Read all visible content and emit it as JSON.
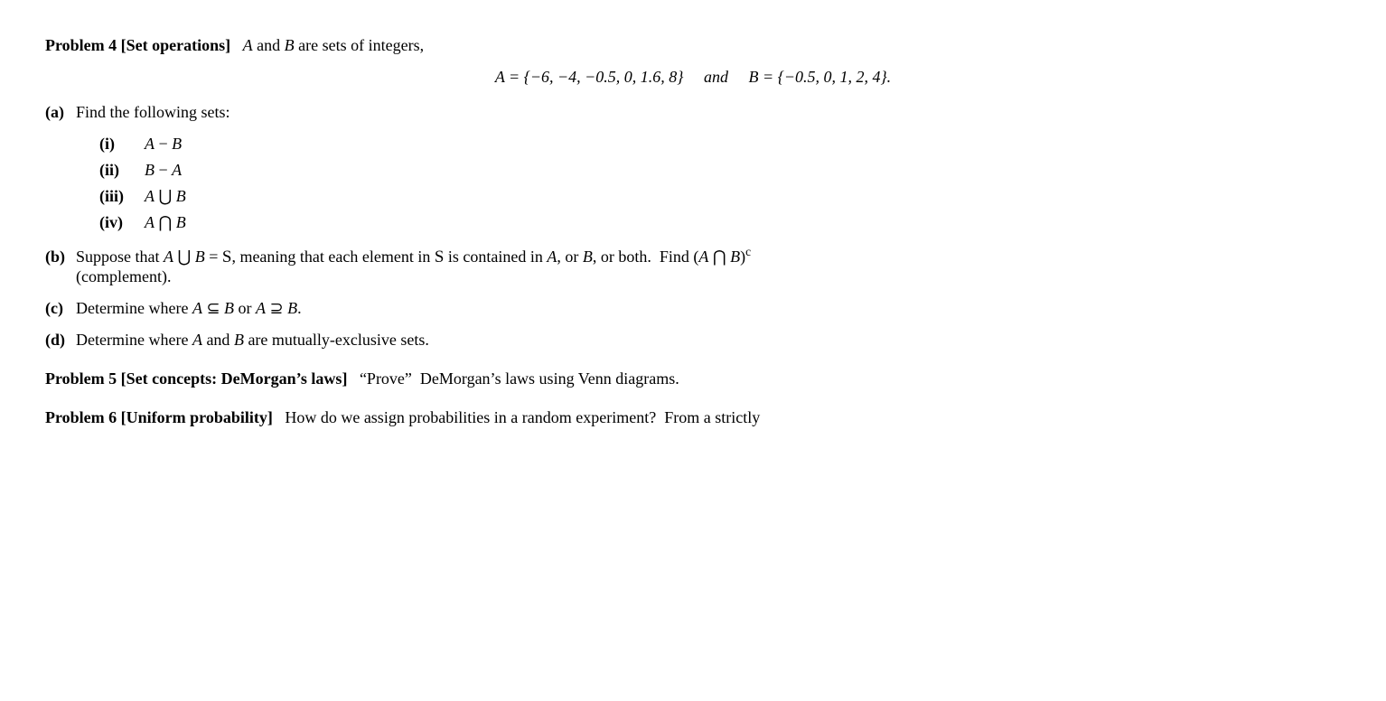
{
  "problems": [
    {
      "id": "problem4",
      "title": "Problem 4",
      "tag": "[Set operations]",
      "intro": "A and B are sets of integers,",
      "display_math": "A = {−6, −4, −0.5, 0, 1.6, 8}   and   B = {−0.5, 0, 1, 2, 4}.",
      "parts": [
        {
          "label": "(a)",
          "text": "Find the following sets:",
          "subparts": [
            {
              "label": "(i)",
              "text": "A − B"
            },
            {
              "label": "(ii)",
              "text": "B − A"
            },
            {
              "label": "(iii)",
              "text": "A ∪ B"
            },
            {
              "label": "(iv)",
              "text": "A ∩ B"
            }
          ]
        },
        {
          "label": "(b)",
          "text": "Suppose that A ∪ B = 𝒮, meaning that each element in 𝒮 is contained in A, or B, or both.  Find (A ∩ B)^c (complement)."
        },
        {
          "label": "(c)",
          "text": "Determine where A ⊆ B or A ⊇ B."
        },
        {
          "label": "(d)",
          "text": "Determine where A and B are mutually-exclusive sets."
        }
      ]
    },
    {
      "id": "problem5",
      "title": "Problem 5",
      "tag": "[Set concepts: DeMorgan's laws]",
      "text": "“Prove”  DeMorgan’s laws using Venn diagrams."
    },
    {
      "id": "problem6",
      "title": "Problem 6",
      "tag": "[Uniform probability]",
      "text": "How do we assign probabilities in a random experiment?  From a strictly"
    }
  ]
}
